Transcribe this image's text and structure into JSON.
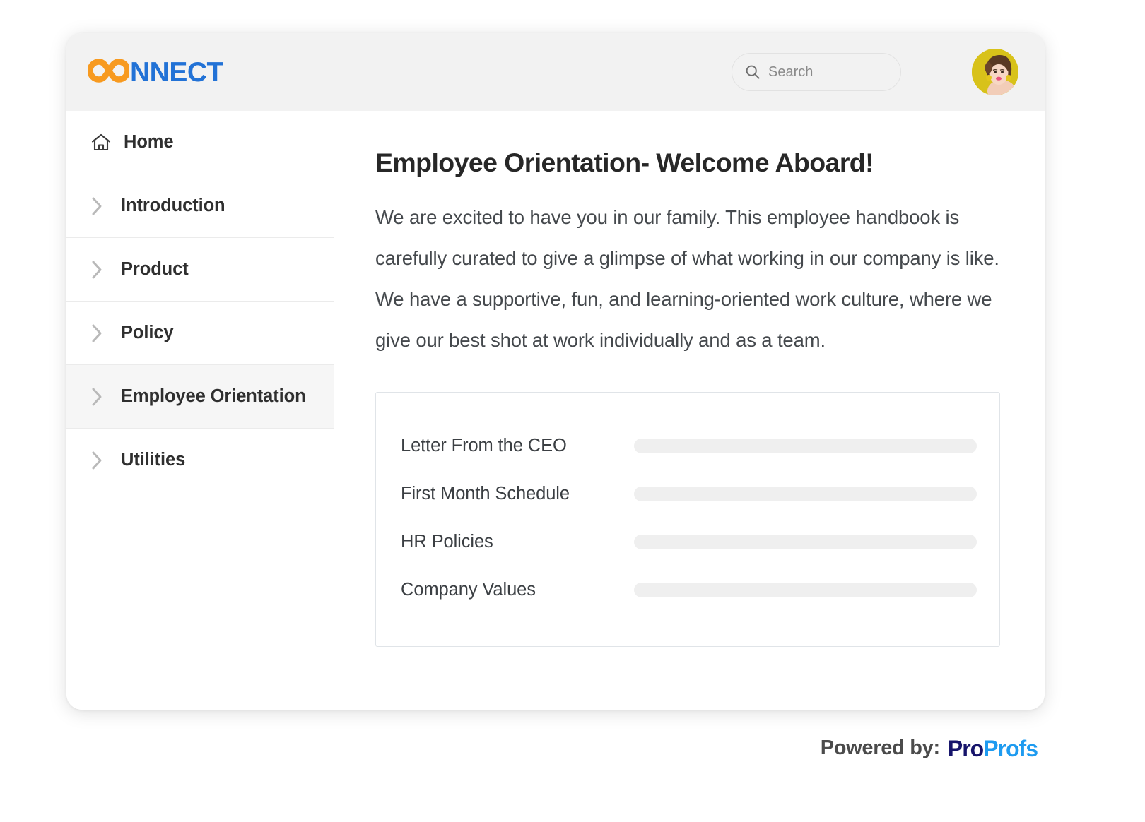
{
  "brand": {
    "mark_icon": "infinity-icon",
    "mark_letters": "CO",
    "text": "NNECT",
    "mark_color": "#f79a20",
    "text_color": "#2272d6"
  },
  "search": {
    "icon": "search-icon",
    "placeholder": "Search",
    "value": ""
  },
  "avatar": {
    "icon": "user-avatar",
    "background_color": "#d8c21a"
  },
  "sidebar": {
    "items": [
      {
        "label": "Home",
        "icon": "home-icon",
        "active": false
      },
      {
        "label": "Introduction",
        "icon": "chevron-right-icon",
        "active": false
      },
      {
        "label": "Product",
        "icon": "chevron-right-icon",
        "active": false
      },
      {
        "label": "Policy",
        "icon": "chevron-right-icon",
        "active": false
      },
      {
        "label": "Employee Orientation",
        "icon": "chevron-right-icon",
        "active": true
      },
      {
        "label": "Utilities",
        "icon": "chevron-right-icon",
        "active": false
      }
    ]
  },
  "main": {
    "title": "Employee Orientation- Welcome Aboard!",
    "paragraph": "We are excited to have you in our family. This employee handbook is carefully curated to give a glimpse of what working in our company is like. We have a supportive, fun, and learning-oriented work culture, where we give our best shot at work individually and as a team.",
    "outline_rows": [
      {
        "label": "Letter From the CEO"
      },
      {
        "label": "First Month Schedule"
      },
      {
        "label": "HR Policies"
      },
      {
        "label": "Company Values"
      }
    ]
  },
  "footer": {
    "powered_by": "Powered by:",
    "logo_part1": "Pro",
    "logo_part2": "Profs",
    "logo_color1": "#16146b",
    "logo_color2": "#1e9bf0"
  }
}
